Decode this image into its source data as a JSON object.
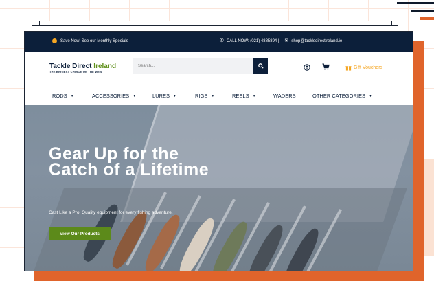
{
  "topbar": {
    "promo_text": "Save Now! See our Monthly Specials",
    "phone_text": "CALL NOW: (021) 4885894 |",
    "email_text": "shop@tackledirectireland.ie",
    "phone_icon": "phone-icon",
    "email_icon": "mail-icon"
  },
  "header": {
    "logo_part1": "Tackle Direct ",
    "logo_part2": "Ireland",
    "logo_tagline": "THE BIGGEST CHOICE ON THE WEB",
    "search_placeholder": "Search...",
    "search_icon": "search-icon",
    "account_icon": "user-icon",
    "cart_icon": "cart-icon",
    "gift_label": "Gift Vouchers",
    "gift_icon": "gift-icon"
  },
  "nav": {
    "items": [
      {
        "label": "RODS"
      },
      {
        "label": "ACCESSORIES"
      },
      {
        "label": "LURES"
      },
      {
        "label": "RIGS"
      },
      {
        "label": "REELS"
      },
      {
        "label": "WADERS"
      },
      {
        "label": "OTHER CATEGORIES"
      }
    ]
  },
  "hero": {
    "title": "Gear Up for the Catch of a Lifetime",
    "subtitle": "Cast Like a Pro: Quality equipment for every fishing adventure.",
    "button_label": "View Our Products"
  },
  "colors": {
    "navy": "#0c1f3a",
    "accent_orange": "#e0642b",
    "green": "#5c8a1a",
    "gold": "#f5a623"
  }
}
